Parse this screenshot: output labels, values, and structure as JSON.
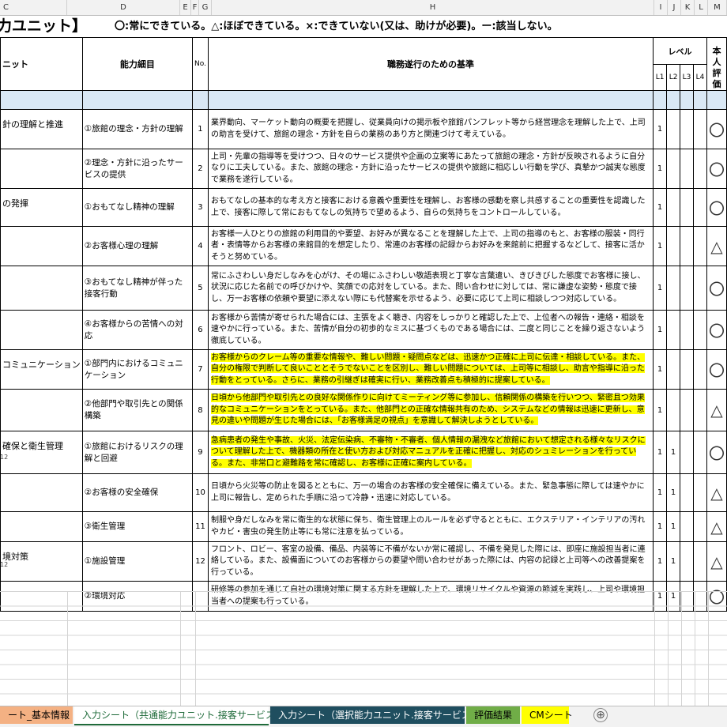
{
  "columns": [
    "C",
    "D",
    "E",
    "F",
    "G",
    "H",
    "I",
    "J",
    "K",
    "L",
    "M"
  ],
  "title": "力ユニット】",
  "legend": "〇:常にできている。△:ほぼできている。×:できていない(又は、助けが必要)。ー:該当しない。",
  "header": {
    "unit": "ニット",
    "detail": "能力細目",
    "no": "No.",
    "criteria": "職務遂行のための基準",
    "level": "レベル",
    "levels": [
      "L1",
      "L2",
      "L3",
      "L4"
    ],
    "eval": "本人評価"
  },
  "rows": [
    {
      "unit": "針の理解と推進",
      "detail": "①旅館の理念・方針の理解",
      "no": "1",
      "criteria": "業界動向、マーケット動向の概要を把握し、従業員向けの掲示板や旅館パンフレット等から経営理念を理解した上で、上司の助言を受けて、旅館の理念・方針を自らの業務のあり方と関連づけて考えている。",
      "l1": "1",
      "l2": "",
      "eval": "〇"
    },
    {
      "unit": "",
      "detail": "②理念・方針に沿ったサービスの提供",
      "no": "2",
      "criteria": "上司・先輩の指導等を受けつつ、日々のサービス提供や企画の立案等にあたって旅館の理念・方針が反映されるように自分なりに工夫している。また、旅館の理念・方針に沿ったサービスの提供や旅館に相応しい行動を学び、真摯かつ誠実な態度で業務を遂行している。",
      "l1": "1",
      "l2": "",
      "eval": "〇"
    },
    {
      "unit": "の発揮",
      "detail": "①おもてなし精神の理解",
      "no": "3",
      "criteria": "おもてなしの基本的な考え方と接客における意義や重要性を理解し、お客様の感動を察し共感することの重要性を認識した上で、接客に際して常におもてなしの気持ちで望めるよう、自らの気持ちをコントロールしている。",
      "l1": "1",
      "l2": "",
      "eval": "〇"
    },
    {
      "unit": "",
      "detail": "②お客様心理の理解",
      "no": "4",
      "criteria": "お客様一人ひとりの旅館の利用目的や要望、お好みが異なることを理解した上で、上司の指導のもと、お客様の服装・同行者・表情等からお客様の来館目的を想定したり、常連のお客様の記録からお好みを来館前に把握するなどして、接客に活かそうと努めている。",
      "l1": "1",
      "l2": "",
      "eval": "△"
    },
    {
      "unit": "",
      "detail": "③おもてなし精神が伴った接客行動",
      "no": "5",
      "criteria": "常にふさわしい身だしなみを心がけ、その場にふさわしい敬語表現と丁寧な言葉遣い、きびきびした態度でお客様に接し、状況に応じた名前での呼びかけや、笑顔での応対をしている。また、問い合わせに対しては、常に謙虚な姿勢・態度で接し、万一お客様の依頼や要望に添えない際にも代替案を示せるよう、必要に応じて上司に相談しつつ対応している。",
      "l1": "1",
      "l2": "",
      "eval": "〇"
    },
    {
      "unit": "",
      "detail": "④お客様からの苦情への対応",
      "no": "6",
      "criteria": "お客様から苦情が寄せられた場合には、主張をよく聴き、内容をしっかりと確認した上で、上位者への報告・連絡・相談を速やかに行っている。また、苦情が自分の初歩的なミスに基づくものである場合には、二度と同じことを繰り返さないよう徹底している。",
      "l1": "1",
      "l2": "",
      "eval": "〇"
    },
    {
      "unit": "コミュニケーション",
      "detail": "①部門内におけるコミュニケーション",
      "no": "7",
      "criteria": "お客様からのクレーム等の重要な情報や、難しい問題・疑問点などは、迅速かつ正確に上司に伝達・相談している。また、自分の権限で判断して良いこととそうでないことを区別し、難しい問題については、上司等に相談し、助言や指導に沿った行動をとっている。さらに、業務の引継ぎは確実に行い、業務改善点も積極的に提案している。",
      "l1": "1",
      "l2": "",
      "eval": "〇"
    },
    {
      "unit": "",
      "detail": "②他部門や取引先との関係構築",
      "no": "8",
      "criteria": "日頃から他部門や取引先との良好な関係作りに向けてミーティング等に参加し、信頼関係の構築を行いつつ、緊密且つ効果的なコミュニケーションをとっている。また、他部門との正確な情報共有のため、システムなどの情報は迅速に更新し、意見の違いや問題が生じた場合には、「お客様満足の視点」を意識して解決しようとしている。",
      "l1": "1",
      "l2": "",
      "eval": "△"
    },
    {
      "unit": "確保と衛生管理",
      "detail": "①旅館におけるリスクの理解と回避",
      "no": "9",
      "criteria": "急病患者の発生や事故、火災、法定伝染病、不審物・不審者、個人情報の漏洩など旅館において想定される様々なリスクについて理解した上で、機器類の所在と使い方および対応マニュアルを正確に把握し、対応のシュミレーションを行っている。また、非常口と避難路を常に確認し、お客様に正確に案内している。",
      "l1": "1",
      "l2": "1",
      "eval": "〇"
    },
    {
      "unit": "",
      "detail": "②お客様の安全確保",
      "no": "10",
      "criteria": "日頃から火災等の防止を図るとともに、万一の場合のお客様の安全確保に備えている。また、緊急事態に際しては速やかに上司に報告し、定められた手順に沿って冷静・迅速に対応している。",
      "l1": "1",
      "l2": "1",
      "eval": "△"
    },
    {
      "unit": "",
      "detail": "③衛生管理",
      "no": "11",
      "criteria": "制服や身だしなみを常に衛生的な状態に保ち、衛生管理上のルールを必ず守るとともに、エクステリア・インテリアの汚れやカビ・害虫の発生防止等にも常に注意を払っている。",
      "l1": "1",
      "l2": "1",
      "eval": "△"
    },
    {
      "unit": "境対策",
      "detail": "①施設管理",
      "no": "12",
      "criteria": "フロント、ロビー、客室の設備、備品、内装等に不備がないか常に確認し、不備を発見した際には、即座に施設担当者に連絡している。また、設備面についてのお客様からの要望や問い合わせがあった際には、内容の記録と上司等への改善提案を行っている。",
      "l1": "1",
      "l2": "1",
      "eval": "△"
    },
    {
      "unit": "",
      "detail": "②環境対応",
      "no": "",
      "criteria": "研修等の参加を通じて自社の環境対策に関する方針を理解した上で、環境リサイクルや資源の節減を実践し、上司や環境担当者への提案も行っている。",
      "l1": "1",
      "l2": "1",
      "eval": "〇"
    }
  ],
  "subnotes": [
    "12",
    "12"
  ],
  "tabs": [
    {
      "label": "ート_基本情報",
      "bg": "#f4b183",
      "fg": "#000000"
    },
    {
      "label": "入力シート（共通能力ユニット.接客サービス）",
      "bg": "#ffffff",
      "fg": "#1f6b3a"
    },
    {
      "label": "入力シート（選択能力ユニット.接客サービス）",
      "bg": "#1f4e5f",
      "fg": "#ffffff"
    },
    {
      "label": "評価結果",
      "bg": "#70ad47",
      "fg": "#000000"
    },
    {
      "label": "CMシート",
      "bg": "#ffff00",
      "fg": "#000000"
    }
  ],
  "add_tab": "⊕"
}
